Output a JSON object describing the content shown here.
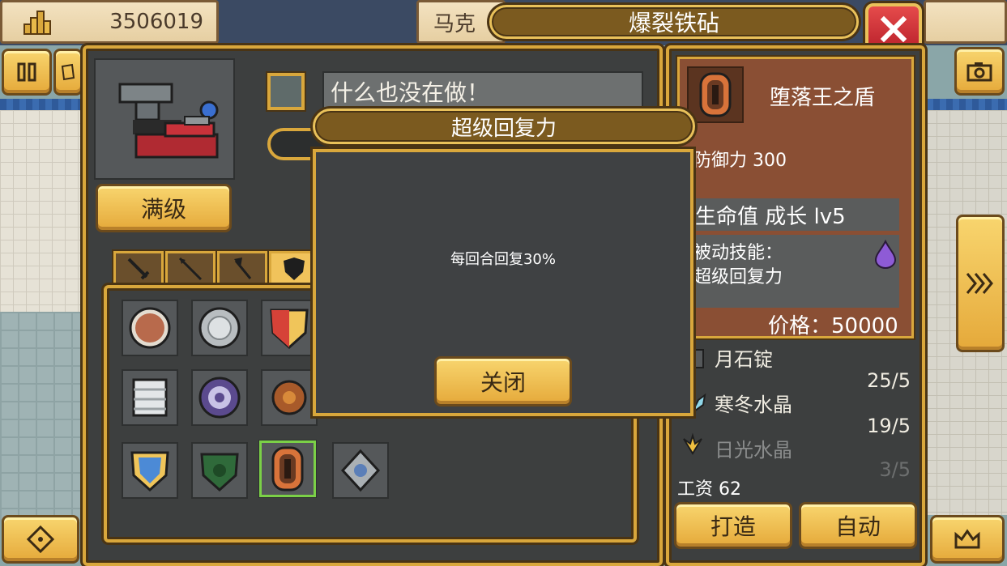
{
  "top_bar": {
    "gold": "3506019",
    "maker_name_partial": "马克",
    "title": "爆裂铁砧",
    "close_icon": "close-icon"
  },
  "left_panel": {
    "anvil_icon": "anvil-icon",
    "full_level_label": "满级",
    "status_text": "什么也没在做！",
    "categories": [
      {
        "icon": "sword-icon"
      },
      {
        "icon": "spear-icon"
      },
      {
        "icon": "axe-icon"
      },
      {
        "icon": "shield-icon",
        "active": true
      }
    ]
  },
  "modal": {
    "title": "超级回复力",
    "description": "每回合回复30%",
    "close_label": "关闭"
  },
  "item_detail": {
    "name": "堕落王之盾",
    "defense": "防御力 300",
    "growth": "生命值 成长 lv5",
    "passive_label": "被动技能：",
    "passive_skill": "超级回复力",
    "price": "价格：50000"
  },
  "materials": [
    {
      "name": "月石锭",
      "count": "25/5",
      "dim": false
    },
    {
      "name": "寒冬水晶",
      "count": "19/5",
      "dim": false
    },
    {
      "name": "日光水晶",
      "count": "3/5",
      "dim": true
    }
  ],
  "wage": "工资 62",
  "actions": {
    "craft_label": "打造",
    "auto_label": "自动"
  },
  "colors": {
    "gold_accent": "#d9a73c",
    "panel_dark": "#3d3f3f",
    "card_brown": "#8a4f34",
    "close_red": "#d33a3a",
    "selected_green": "#7bd047"
  }
}
